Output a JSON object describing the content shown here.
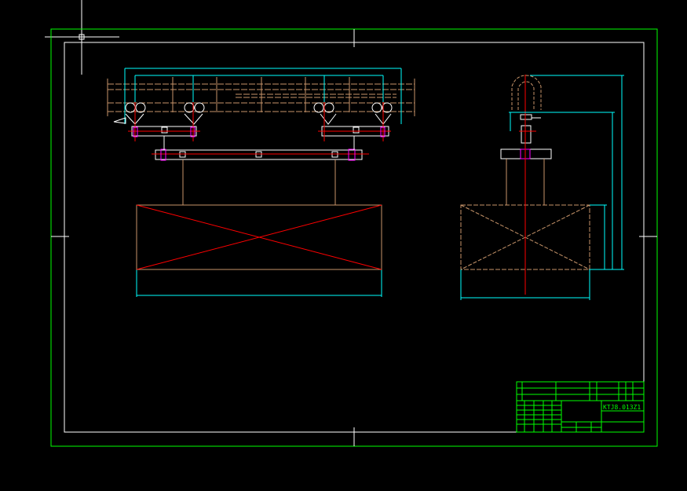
{
  "drawing": {
    "drawing_number": "KTJ8.013Z1",
    "colors": {
      "background": "#000000",
      "frame": "#00ff00",
      "outline": "#ffffff",
      "structure": "#c8956a",
      "dimension": "#00ffff",
      "centerline": "#ff0000",
      "bolt": "#ff00ff"
    }
  }
}
